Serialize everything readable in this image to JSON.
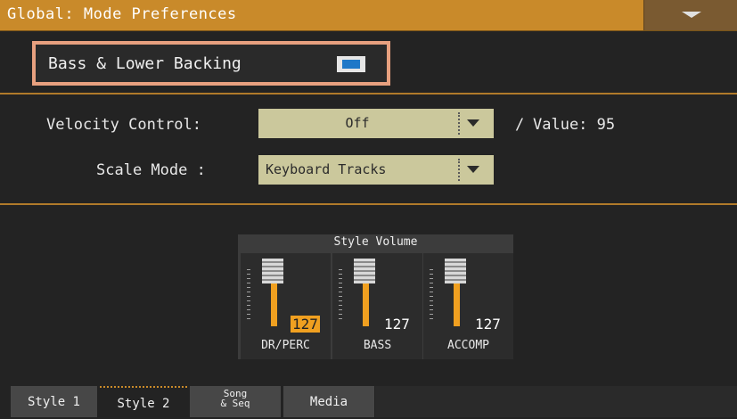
{
  "header": {
    "title": "Global: Mode Preferences",
    "menu_icon": "triangle-down-icon"
  },
  "bass_lower_backing": {
    "label": "Bass & Lower Backing",
    "checked": true
  },
  "velocity_control": {
    "label": "Velocity Control:",
    "value": "Off",
    "separator": "/",
    "value_readout": "Value: 95"
  },
  "scale_mode": {
    "label": "Scale Mode :",
    "value": "Keyboard Tracks"
  },
  "style_volume": {
    "title": "Style Volume",
    "channels": [
      {
        "name": "DR/PERC",
        "value": "127",
        "selected": true
      },
      {
        "name": "BASS",
        "value": "127",
        "selected": false
      },
      {
        "name": "ACCOMP",
        "value": "127",
        "selected": false
      }
    ]
  },
  "tabs": [
    {
      "label": "Style 1",
      "active": false
    },
    {
      "label": "Style 2",
      "active": true
    },
    {
      "label": "Song\n& Seq",
      "active": false
    },
    {
      "label": "Media",
      "active": false
    }
  ],
  "colors": {
    "title_bar": "#c98a2a",
    "accent": "#f0a020",
    "highlight_box": "#e7a07f",
    "dropdown": "#cbc89c",
    "checkbox": "#1f78c8"
  }
}
